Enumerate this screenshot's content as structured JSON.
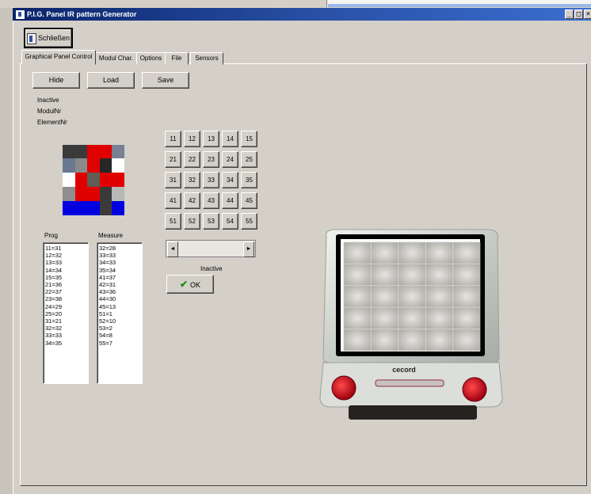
{
  "window": {
    "title": "P.I.G. Panel IR pattern Generator",
    "controls": [
      "_",
      "□",
      "×"
    ]
  },
  "toolbar": {
    "close_label": "Schließen"
  },
  "tabs": [
    {
      "label": "Graphical Panel Control",
      "active": true
    },
    {
      "label": "Modul Char."
    },
    {
      "label": "Options"
    },
    {
      "label": "File"
    },
    {
      "label": "Sensors"
    }
  ],
  "actions": {
    "hide": "Hide",
    "load": "Load",
    "save": "Save"
  },
  "info": {
    "status": "Inactive",
    "module_nr": "ModulNr",
    "element_nr": "ElementNr"
  },
  "element_grid": [
    [
      "11",
      "12",
      "13",
      "14",
      "15"
    ],
    [
      "21",
      "22",
      "23",
      "24",
      "25"
    ],
    [
      "31",
      "32",
      "33",
      "34",
      "35"
    ],
    [
      "41",
      "42",
      "43",
      "44",
      "45"
    ],
    [
      "51",
      "52",
      "53",
      "54",
      "55"
    ]
  ],
  "pattern_colors": [
    [
      "#3a3a3a",
      "#3a3a3a",
      "#e00000",
      "#e00000",
      "#7a8094"
    ],
    [
      "#6a7890",
      "#8a8a8a",
      "#e00000",
      "#262626",
      "#ffffff"
    ],
    [
      "#ffffff",
      "#e00000",
      "#5e5e54",
      "#e00000",
      "#e00000"
    ],
    [
      "#8e8e8e",
      "#e00000",
      "#e00000",
      "#3a3a3a",
      "#b8b8b8"
    ],
    [
      "#0000e0",
      "#0000e0",
      "#0000e0",
      "#3a3a3a",
      "#0000e0"
    ]
  ],
  "lists": {
    "prog_header": "Prog",
    "measure_header": "Measure",
    "prog": [
      "11=31",
      "12=32",
      "13=33",
      "14=34",
      "15=35",
      "21=36",
      "22=37",
      "23=38",
      "24=29",
      "25=20",
      "31=21",
      "32=32",
      "33=33",
      "34=35"
    ],
    "measure": [
      "32=28",
      "33=33",
      "34=33",
      "35=34",
      "41=37",
      "42=31",
      "43=36",
      "44=30",
      "45=13",
      "51=1",
      "52=10",
      "53=2",
      "54=8",
      "55=7"
    ]
  },
  "slider": {
    "left_arrow": "◄",
    "right_arrow": "►",
    "status": "Inactive"
  },
  "ok_button": {
    "label": "OK",
    "icon": "check-icon"
  },
  "monitor": {
    "brand": "cecord"
  }
}
